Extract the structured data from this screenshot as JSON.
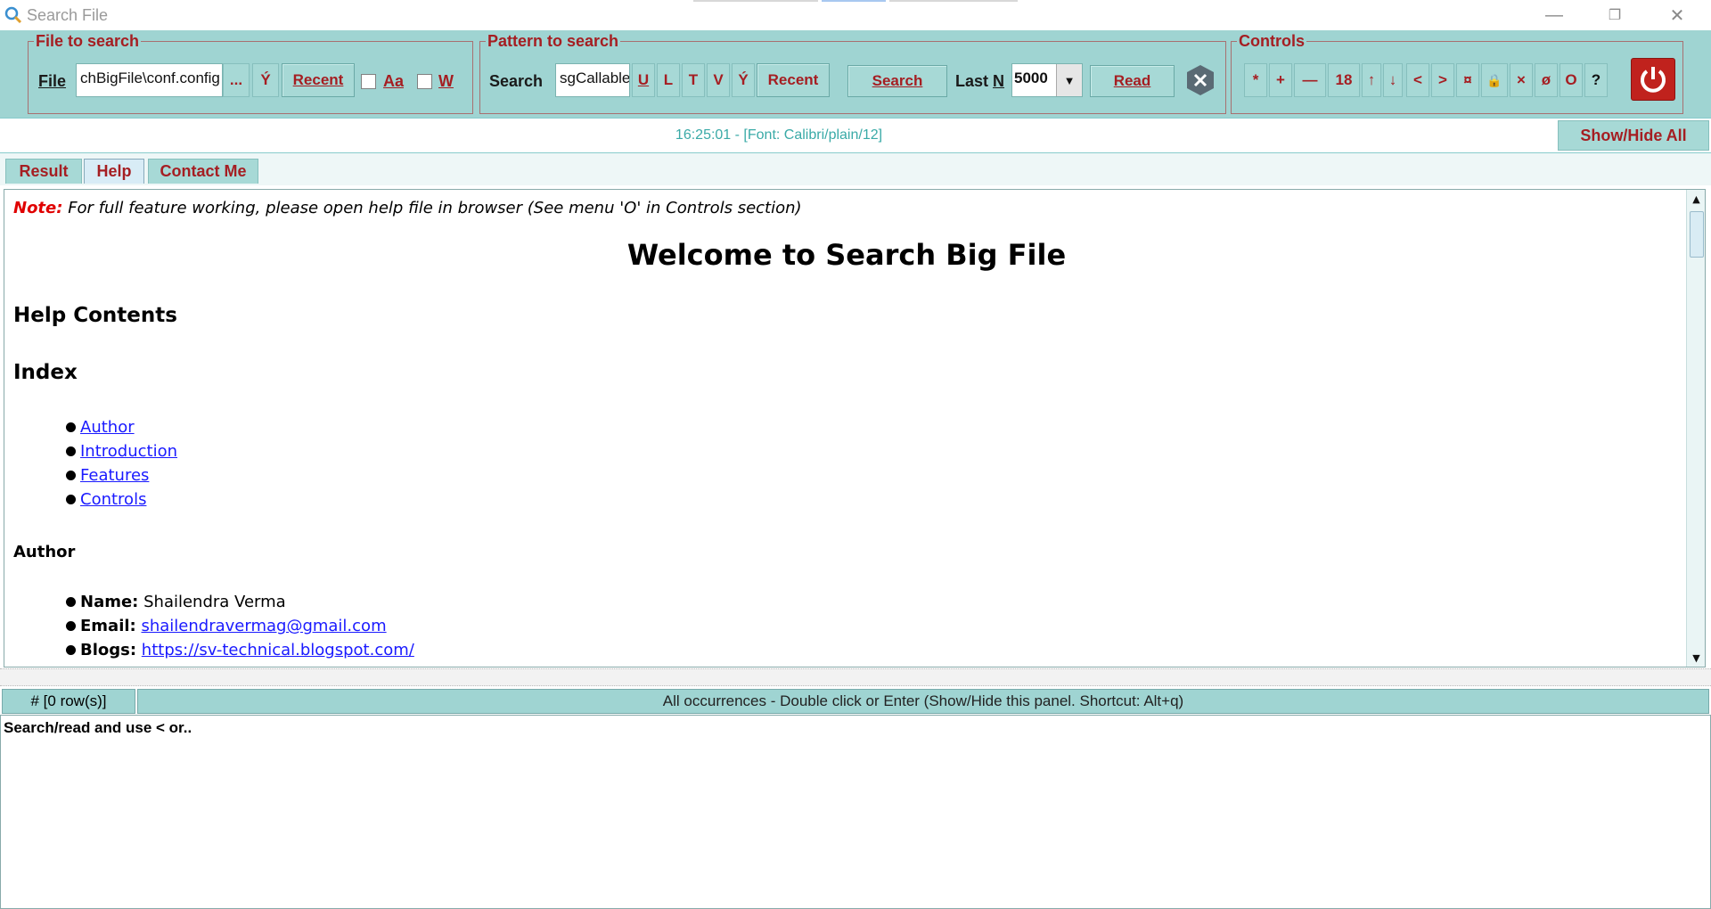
{
  "window": {
    "title": "Search File",
    "minimize": "—",
    "restore": "❐",
    "close": "✕"
  },
  "file_group": {
    "legend": "File to search",
    "label": "File",
    "value": "chBigFile\\conf.config",
    "browse": "...",
    "y_button": "Ý",
    "recent": "Recent",
    "match_case": "Aa",
    "whole_word": "W"
  },
  "pattern_group": {
    "legend": "Pattern to search",
    "label": "Search",
    "value": "sgCallable",
    "u": "U",
    "l": "L",
    "t": "T",
    "v": "V",
    "y": "Ý",
    "recent": "Recent",
    "search": "Search",
    "last_n_label": "Last",
    "last_n_key": "N",
    "last_n_value": "5000",
    "read": "Read"
  },
  "controls_group": {
    "legend": "Controls",
    "buttons": [
      "*",
      "+",
      "—",
      "18",
      "↑",
      "↓",
      "<",
      ">",
      "¤",
      "🔒",
      "×",
      "ø",
      "O",
      "?"
    ]
  },
  "status": {
    "text": "16:25:01 - [Font: Calibri/plain/12]",
    "show_hide_all": "Show/Hide All"
  },
  "tabs": [
    "Result",
    "Help",
    "Contact Me"
  ],
  "help": {
    "note_label": "Note:",
    "note_text": "For full feature working, please open help file in browser (See menu 'O' in Controls section)",
    "welcome": "Welcome to Search Big File",
    "help_contents": "Help Contents",
    "index": "Index",
    "index_links": [
      "Author",
      "Introduction",
      "Features",
      "Controls"
    ],
    "author_heading": "Author",
    "name_label": "Name:",
    "name_value": "Shailendra Verma",
    "email_label": "Email:",
    "email_value": "shailendravermag@gmail.com",
    "blogs_label": "Blogs:",
    "blogs_value": "https://sv-technical.blogspot.com/"
  },
  "occurrences": {
    "count": "# [0 row(s)]",
    "title": "All occurrences - Double click or Enter (Show/Hide this panel.  Shortcut: Alt+q)",
    "message": "Search/read and use < or.."
  },
  "colors": {
    "toolbar_bg": "#9fd4d2",
    "accent_text": "#a51e22",
    "status_text": "#3aaaa7",
    "link": "#1a1aff",
    "note_red": "#e00000",
    "power_red": "#c0221d"
  }
}
